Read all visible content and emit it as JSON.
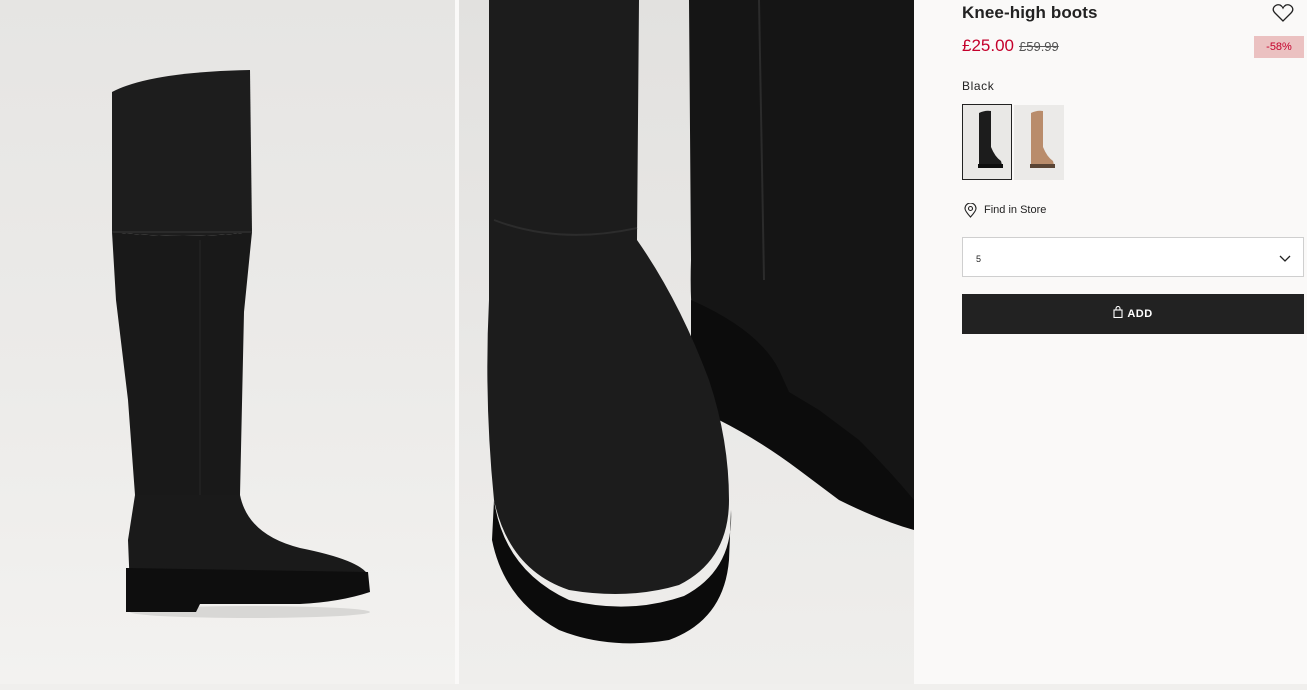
{
  "product": {
    "title": "Knee-high boots",
    "price_now": "£25.00",
    "price_old": "£59.99",
    "discount": "-58%",
    "color_label": "Black"
  },
  "swatches": [
    {
      "name": "Black",
      "color": "#1c1c1c",
      "selected": true
    },
    {
      "name": "Camel",
      "color": "#b98c6b",
      "selected": false
    }
  ],
  "actions": {
    "find_in_store": "Find in Store",
    "size_value": "5",
    "add_label": "ADD"
  },
  "icons": {
    "favorite": "heart-icon",
    "location": "map-pin-icon",
    "dropdown": "chevron-down-icon",
    "bag": "shopping-bag-icon"
  },
  "colors": {
    "price_sale": "#c4002b",
    "badge_bg": "#ebc1c1",
    "button_bg": "#222222"
  }
}
